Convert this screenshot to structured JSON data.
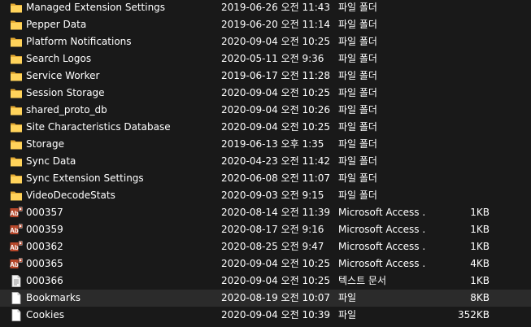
{
  "colors": {
    "background": "#191919",
    "text": "#ffffff",
    "folder_icon": "#ffd35b",
    "selected_row": "#2b2b2b",
    "access_icon": "#b7472a"
  },
  "files": [
    {
      "name": "Managed Extension Settings",
      "date": "2019-06-26 오전 11:43",
      "type": "파일 폴더",
      "size": "",
      "icon": "folder-icon"
    },
    {
      "name": "Pepper Data",
      "date": "2019-06-20 오전 11:14",
      "type": "파일 폴더",
      "size": "",
      "icon": "folder-icon"
    },
    {
      "name": "Platform Notifications",
      "date": "2020-09-04 오전 10:25",
      "type": "파일 폴더",
      "size": "",
      "icon": "folder-icon"
    },
    {
      "name": "Search Logos",
      "date": "2020-05-11 오전 9:36",
      "type": "파일 폴더",
      "size": "",
      "icon": "folder-icon"
    },
    {
      "name": "Service Worker",
      "date": "2019-06-17 오전 11:28",
      "type": "파일 폴더",
      "size": "",
      "icon": "folder-icon"
    },
    {
      "name": "Session Storage",
      "date": "2020-09-04 오전 10:25",
      "type": "파일 폴더",
      "size": "",
      "icon": "folder-icon"
    },
    {
      "name": "shared_proto_db",
      "date": "2020-09-04 오전 10:26",
      "type": "파일 폴더",
      "size": "",
      "icon": "folder-icon"
    },
    {
      "name": "Site Characteristics Database",
      "date": "2020-09-04 오전 10:25",
      "type": "파일 폴더",
      "size": "",
      "icon": "folder-icon"
    },
    {
      "name": "Storage",
      "date": "2019-06-13 오후 1:35",
      "type": "파일 폴더",
      "size": "",
      "icon": "folder-icon"
    },
    {
      "name": "Sync Data",
      "date": "2020-04-23 오전 11:42",
      "type": "파일 폴더",
      "size": "",
      "icon": "folder-icon"
    },
    {
      "name": "Sync Extension Settings",
      "date": "2020-06-08 오전 11:07",
      "type": "파일 폴더",
      "size": "",
      "icon": "folder-icon"
    },
    {
      "name": "VideoDecodeStats",
      "date": "2020-09-03 오전 9:15",
      "type": "파일 폴더",
      "size": "",
      "icon": "folder-icon"
    },
    {
      "name": "000357",
      "date": "2020-08-14 오전 11:39",
      "type": "Microsoft Access ...",
      "size": "1KB",
      "icon": "access-file-icon"
    },
    {
      "name": "000359",
      "date": "2020-08-17 오전 9:16",
      "type": "Microsoft Access ...",
      "size": "1KB",
      "icon": "access-file-icon"
    },
    {
      "name": "000362",
      "date": "2020-08-25 오전 9:47",
      "type": "Microsoft Access ...",
      "size": "1KB",
      "icon": "access-file-icon"
    },
    {
      "name": "000365",
      "date": "2020-09-04 오전 10:25",
      "type": "Microsoft Access ...",
      "size": "4KB",
      "icon": "access-file-icon"
    },
    {
      "name": "000366",
      "date": "2020-09-04 오전 10:25",
      "type": "텍스트 문서",
      "size": "1KB",
      "icon": "text-file-icon"
    },
    {
      "name": "Bookmarks",
      "date": "2020-08-19 오전 10:07",
      "type": "파일",
      "size": "8KB",
      "icon": "file-icon",
      "selected": true
    },
    {
      "name": "Cookies",
      "date": "2020-09-04 오전 10:39",
      "type": "파일",
      "size": "352KB",
      "icon": "file-icon"
    }
  ]
}
